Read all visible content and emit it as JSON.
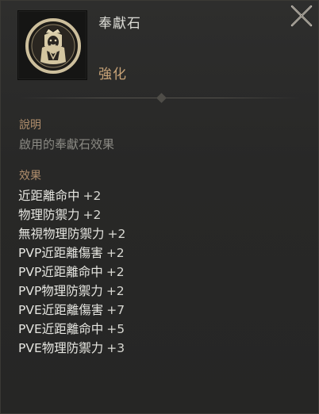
{
  "item": {
    "name": "奉獻石",
    "grade": "強化",
    "icon": "saint-shield-emblem-icon"
  },
  "description": {
    "title": "說明",
    "text": "啟用的奉獻石效果"
  },
  "effects": {
    "title": "效果",
    "list": [
      {
        "label": "近距離命中",
        "value": "+2"
      },
      {
        "label": "物理防禦力",
        "value": "+2"
      },
      {
        "label": "無視物理防禦力",
        "value": "+2"
      },
      {
        "label": "PVP近距離傷害",
        "value": "+2"
      },
      {
        "label": "PVP近距離命中",
        "value": "+2"
      },
      {
        "label": "PVP物理防禦力",
        "value": "+2"
      },
      {
        "label": "PVE近距離傷害",
        "value": "+7"
      },
      {
        "label": "PVE近距離命中",
        "value": "+5"
      },
      {
        "label": "PVE物理防禦力",
        "value": "+3"
      }
    ]
  },
  "colors": {
    "background": "#272726",
    "grade": "#c9a478",
    "section_title": "#b08e6c",
    "effect_text": "#e6e6e1",
    "description_text": "#8a8983"
  }
}
